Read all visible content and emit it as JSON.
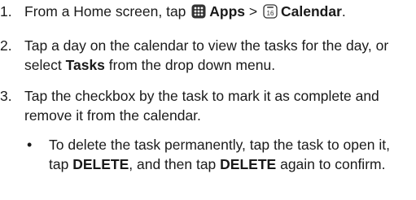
{
  "steps": [
    {
      "number": "1.",
      "prefix": "From a Home screen, tap",
      "apps_label": "Apps",
      "separator": ">",
      "calendar_icon_text": "16",
      "calendar_label": "Calendar",
      "suffix": "."
    },
    {
      "number": "2.",
      "text_before": "Tap a day on the calendar to view the tasks for the day, or select",
      "bold": "Tasks",
      "text_after": "from the drop down menu."
    },
    {
      "number": "3.",
      "text": "Tap the checkbox by the task to mark it as complete and remove it from the calendar."
    }
  ],
  "sub_bullet": {
    "bullet": "•",
    "part1": "To delete the task permanently, tap the task to open it, tap",
    "bold1": "DELETE",
    "part2": ", and then tap",
    "bold2": "DELETE",
    "part3": "again to confirm."
  },
  "icons": {
    "apps": "apps-grid-icon",
    "calendar": "calendar-icon"
  },
  "colors": {
    "text": "#1a1a1a",
    "icon_fill": "#333333"
  }
}
